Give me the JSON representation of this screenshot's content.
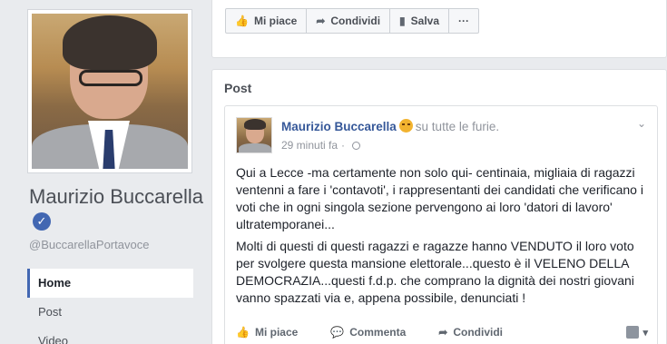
{
  "page": {
    "name": "Maurizio Buccarella",
    "handle": "@BuccarellaPortavoce"
  },
  "nav": {
    "items": [
      {
        "label": "Home",
        "active": true
      },
      {
        "label": "Post",
        "active": false
      },
      {
        "label": "Video",
        "active": false
      }
    ]
  },
  "top_actions": {
    "like": "Mi piace",
    "share": "Condividi",
    "save": "Salva",
    "more": "···"
  },
  "section": {
    "title": "Post"
  },
  "post": {
    "author": "Maurizio Buccarella",
    "feeling": "su tutte le furie.",
    "time": "29 minuti fa",
    "paragraph1": "Qui a Lecce -ma certamente non solo qui- centinaia, migliaia di ragazzi ventenni a fare i 'contavoti', i rappresentanti dei candidati che verificano i voti che in ogni singola sezione pervengono ai loro 'datori di lavoro' ultratemporanei...",
    "paragraph2": "Molti di questi di questi ragazzi e ragazze hanno VENDUTO il loro voto per svolgere questa mansione elettorale...questo è il VELENO DELLA DEMOCRAZIA...questi f.d.p. che comprano la dignità dei nostri giovani vanno spazzati via e, appena possibile, denunciati !",
    "actions": {
      "like": "Mi piace",
      "comment": "Commenta",
      "share": "Condividi"
    }
  },
  "colors": {
    "brand_blue": "#4267b2",
    "link_blue": "#365899",
    "background": "#e9ebee"
  }
}
